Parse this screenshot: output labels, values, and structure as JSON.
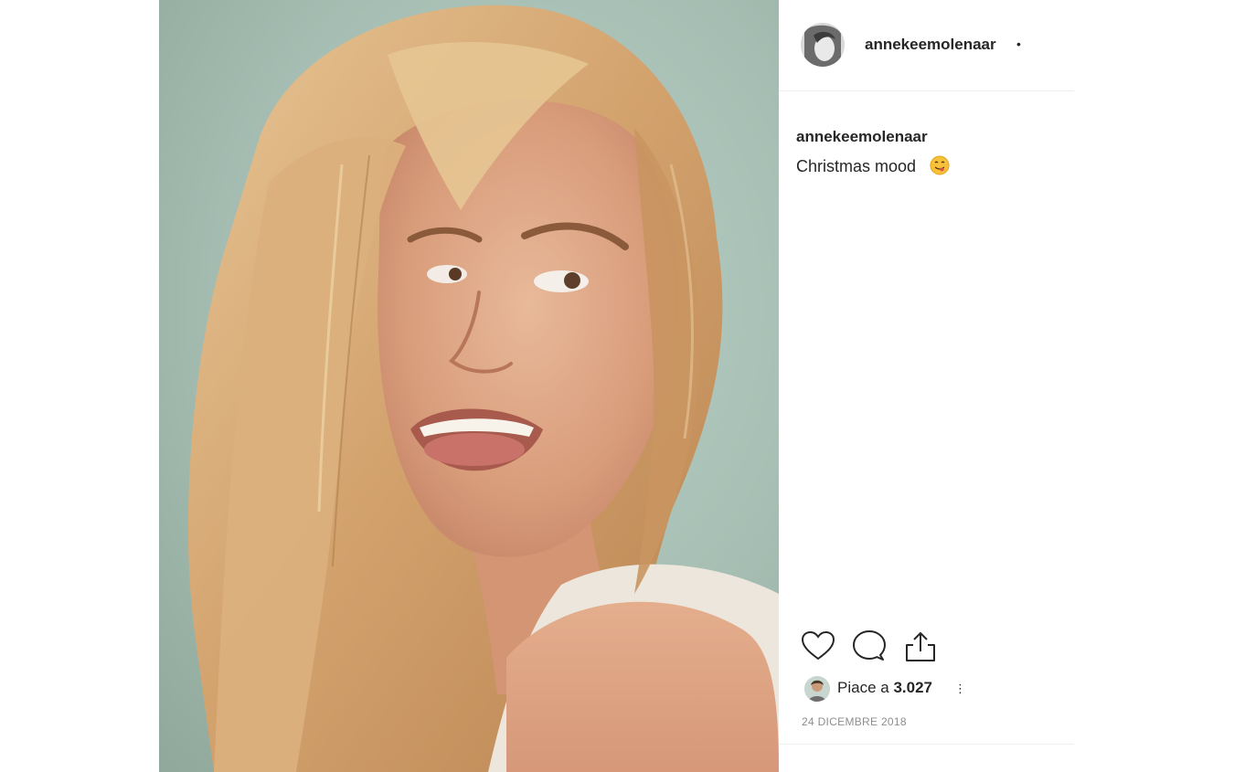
{
  "post": {
    "username": "annekeemolenaar",
    "header_separator": "•",
    "caption_username": "annekeemolenaar",
    "caption_text": "Christmas mood",
    "caption_emoji": "face-savoring-food-emoji",
    "likes_prefix": "Piace a",
    "likes_count": "3.027",
    "more_glyph": "⋮",
    "date": "24 DICEMBRE 2018"
  },
  "icons": {
    "like": "heart-icon",
    "comment": "comment-bubble-icon",
    "share": "share-icon"
  },
  "colors": {
    "text": "#262626",
    "muted": "#8e8e8e",
    "divider": "#efefef",
    "photo_background": "#a6beb3"
  }
}
